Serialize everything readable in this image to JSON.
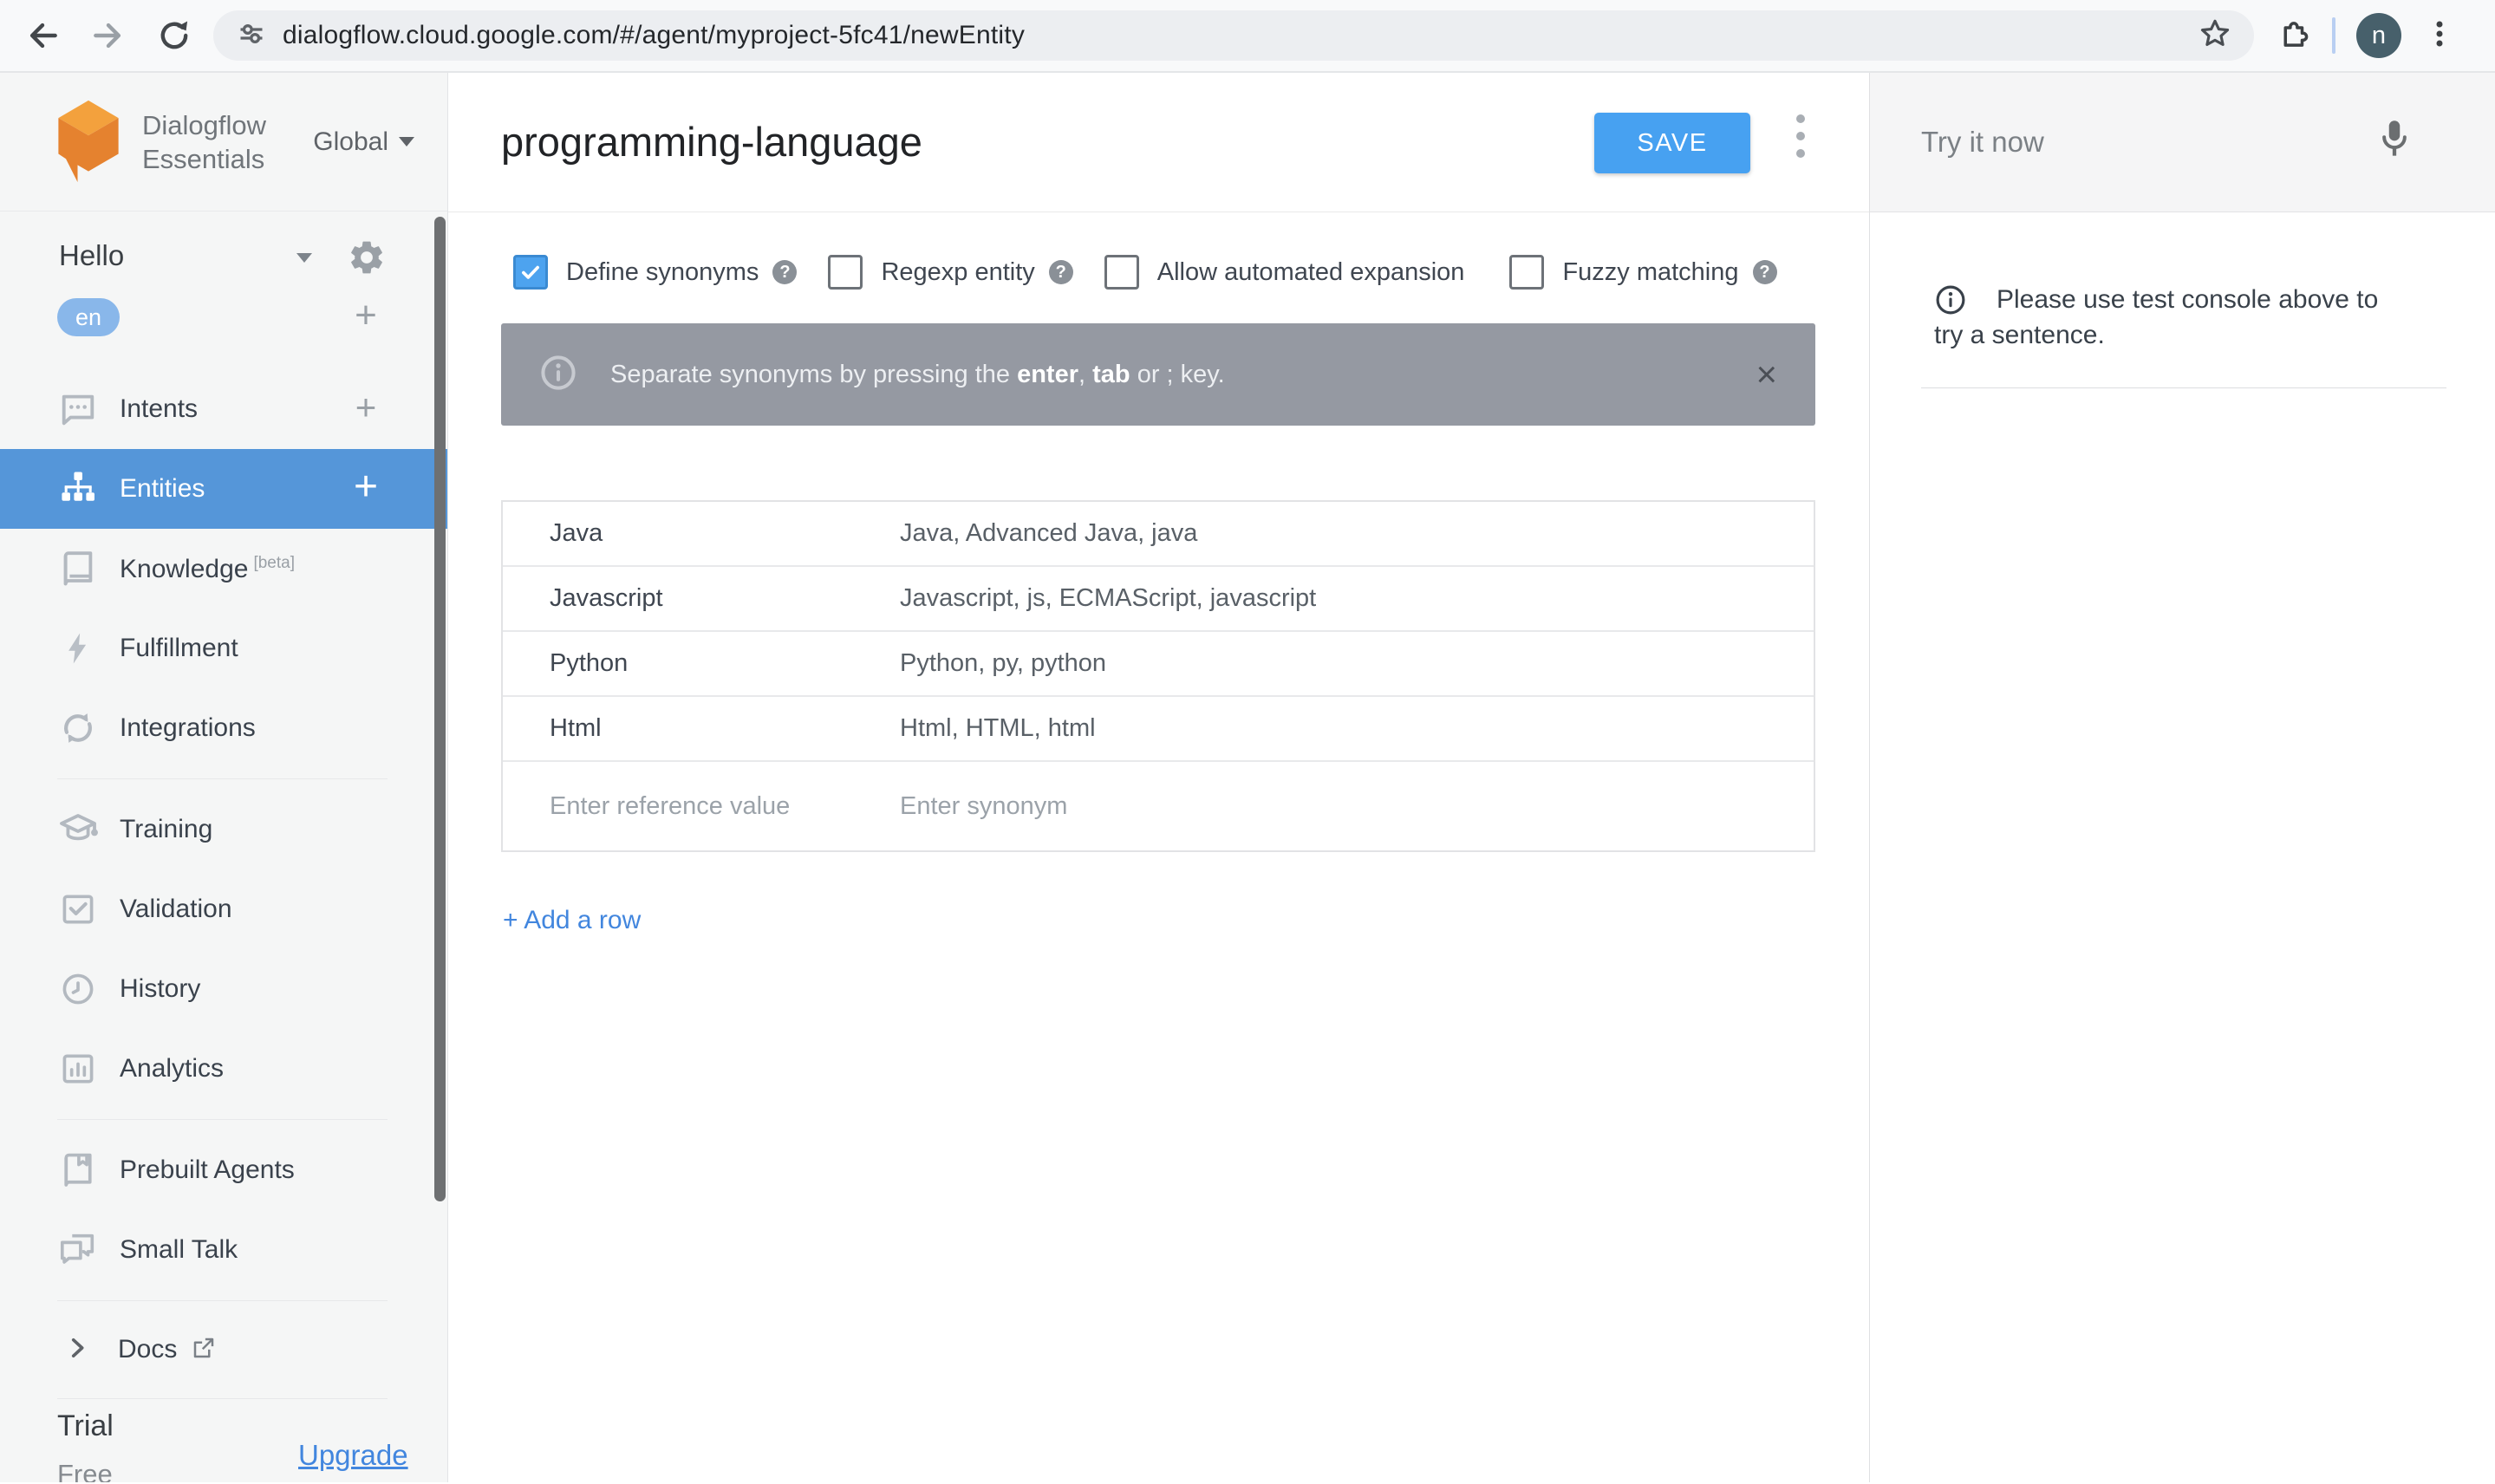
{
  "browser": {
    "url": "dialogflow.cloud.google.com/#/agent/myproject-5fc41/newEntity",
    "avatar_initial": "n"
  },
  "sidebar": {
    "brand": {
      "line1": "Dialogflow",
      "line2": "Essentials",
      "region_label": "Global"
    },
    "agent": {
      "name": "Hello",
      "language": "en"
    },
    "items": [
      {
        "label": "Intents",
        "has_add": true,
        "selected": false
      },
      {
        "label": "Entities",
        "has_add": true,
        "selected": true
      },
      {
        "label": "Knowledge",
        "badge": "[beta]"
      },
      {
        "label": "Fulfillment"
      },
      {
        "label": "Integrations"
      },
      {
        "label": "Training"
      },
      {
        "label": "Validation"
      },
      {
        "label": "History"
      },
      {
        "label": "Analytics"
      },
      {
        "label": "Prebuilt Agents"
      },
      {
        "label": "Small Talk"
      }
    ],
    "docs_label": "Docs",
    "plan": {
      "tier": "Trial",
      "price": "Free",
      "upgrade_label": "Upgrade"
    }
  },
  "header": {
    "entity_name": "programming-language",
    "save_label": "SAVE"
  },
  "options": [
    {
      "label": "Define synonyms",
      "checked": true,
      "has_help": true
    },
    {
      "label": "Regexp entity",
      "checked": false,
      "has_help": true
    },
    {
      "label": "Allow automated expansion",
      "checked": false,
      "has_help": false
    },
    {
      "label": "Fuzzy matching",
      "checked": false,
      "has_help": true
    }
  ],
  "banner": {
    "prefix": "Separate synonyms by pressing the ",
    "key1": "enter",
    "mid": ", ",
    "key2": "tab",
    "suffix": " or ; key.",
    "close_glyph": "×"
  },
  "entity_table": {
    "rows": [
      {
        "value": "Java",
        "synonyms": "Java, Advanced Java, java"
      },
      {
        "value": "Javascript",
        "synonyms": "Javascript, js, ECMAScript, javascript"
      },
      {
        "value": "Python",
        "synonyms": "Python, py, python"
      },
      {
        "value": "Html",
        "synonyms": "Html, HTML, html"
      }
    ],
    "value_placeholder": "Enter reference value",
    "synonym_placeholder": "Enter synonym",
    "add_row_label": "+ Add a row"
  },
  "test_console": {
    "placeholder": "Try it now",
    "message": "Please use test console above to try a sentence."
  },
  "glyphs": {
    "plus": "+",
    "help": "?"
  },
  "colors": {
    "selected_item_blue": "#5596d9",
    "save_button_blue": "#47a1f1",
    "link_blue": "#4286de",
    "lang_badge_blue": "#89b7ea",
    "checkbox_checked_blue": "#4da3ef",
    "banner_gray": "#9599a2",
    "logo_orange_top": "#f3a13d",
    "logo_orange_body": "#e5822f"
  },
  "icons": [
    "back-icon",
    "forward-icon",
    "reload-icon",
    "site-settings-icon",
    "bookmark-star-icon",
    "extensions-puzzle-icon",
    "browser-menu-kebab-icon",
    "dialogflow-logo",
    "gear-icon",
    "chevron-down-icon",
    "plus-icon",
    "intents-chat-icon",
    "entities-sitemap-icon",
    "knowledge-book-icon",
    "fulfillment-bolt-icon",
    "integrations-sync-icon",
    "training-cap-icon",
    "validation-check-icon",
    "history-clock-icon",
    "analytics-chart-icon",
    "prebuilt-agents-book-icon",
    "small-talk-bubbles-icon",
    "chevron-right-icon",
    "external-link-icon",
    "info-icon",
    "help-icon",
    "close-icon",
    "mic-icon",
    "more-kebab-icon"
  ]
}
